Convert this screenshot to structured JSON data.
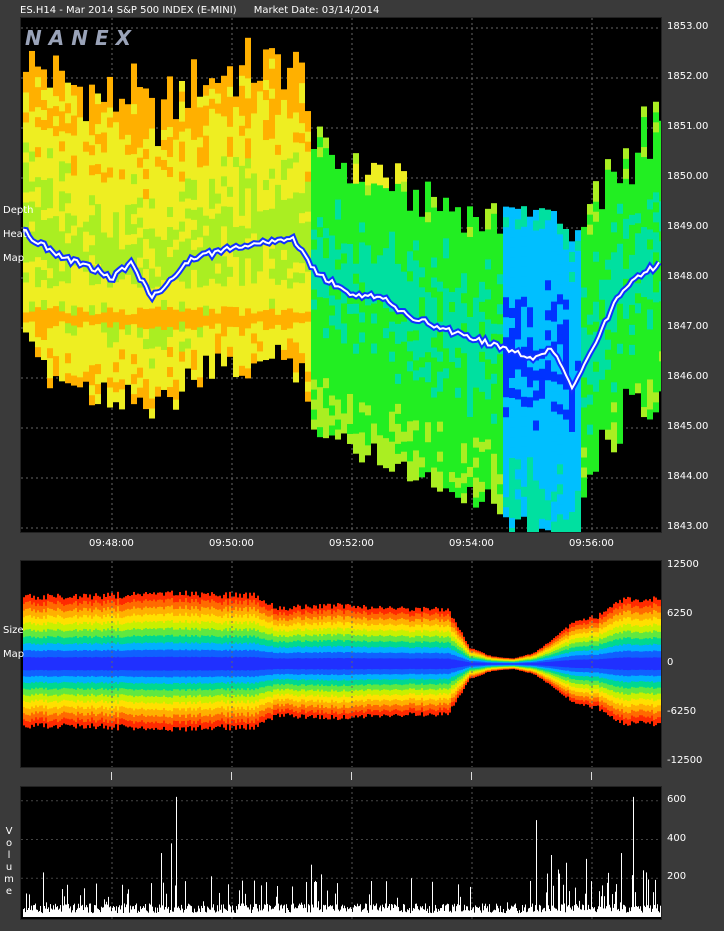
{
  "header": {
    "instrument": "ES.H14 - Mar 2014 S&P 500 INDEX (E-MINI)",
    "market_date": "Market Date: 03/14/2014"
  },
  "brand": "NANEX",
  "panels": {
    "heat": {
      "label": "Depth\n\nHeat\n\nMap"
    },
    "size": {
      "label": "Size\n\nMap"
    },
    "volume": {
      "label": "Volume"
    }
  },
  "chart_data": [
    {
      "type": "heatmap",
      "title": "Depth Heat Map",
      "xlabel": "",
      "ylabel": "",
      "x_ticks": [
        "09:48:00",
        "09:50:00",
        "09:52:00",
        "09:54:00",
        "09:56:00"
      ],
      "y_ticks": [
        "1853.00",
        "1852.00",
        "1851.00",
        "1850.00",
        "1849.00",
        "1848.00",
        "1847.00",
        "1846.00",
        "1845.00",
        "1844.00",
        "1843.00"
      ],
      "ylim": [
        1843,
        1853
      ],
      "price_path": [
        {
          "t": "09:46:15",
          "p": 1849.4
        },
        {
          "t": "09:46:40",
          "p": 1848.8
        },
        {
          "t": "09:47:10",
          "p": 1848.4
        },
        {
          "t": "09:47:40",
          "p": 1848.2
        },
        {
          "t": "09:48:00",
          "p": 1848.0
        },
        {
          "t": "09:48:20",
          "p": 1848.3
        },
        {
          "t": "09:48:40",
          "p": 1847.6
        },
        {
          "t": "09:49:00",
          "p": 1848.0
        },
        {
          "t": "09:49:20",
          "p": 1848.4
        },
        {
          "t": "09:49:40",
          "p": 1848.5
        },
        {
          "t": "09:50:00",
          "p": 1848.6
        },
        {
          "t": "09:50:30",
          "p": 1848.7
        },
        {
          "t": "09:51:00",
          "p": 1848.8
        },
        {
          "t": "09:51:20",
          "p": 1848.2
        },
        {
          "t": "09:51:40",
          "p": 1847.9
        },
        {
          "t": "09:52:00",
          "p": 1847.7
        },
        {
          "t": "09:52:30",
          "p": 1847.6
        },
        {
          "t": "09:53:00",
          "p": 1847.2
        },
        {
          "t": "09:53:30",
          "p": 1847.0
        },
        {
          "t": "09:54:00",
          "p": 1846.8
        },
        {
          "t": "09:54:30",
          "p": 1846.6
        },
        {
          "t": "09:55:00",
          "p": 1846.4
        },
        {
          "t": "09:55:20",
          "p": 1846.6
        },
        {
          "t": "09:55:40",
          "p": 1845.8
        },
        {
          "t": "09:56:00",
          "p": 1846.6
        },
        {
          "t": "09:56:20",
          "p": 1847.4
        },
        {
          "t": "09:56:40",
          "p": 1848.0
        },
        {
          "t": "09:57:10",
          "p": 1848.3
        }
      ]
    },
    {
      "type": "area",
      "title": "Size Map",
      "y_ticks": [
        "12500",
        "6250",
        "0",
        "-6250",
        "-12500"
      ],
      "ylim": [
        -12500,
        12500
      ],
      "series": [
        {
          "values": [
            8800,
            8600,
            8700,
            8700,
            8800,
            8900,
            8900,
            9000,
            9000,
            8900,
            8900,
            8800,
            7200,
            7300,
            7400,
            7500,
            7300,
            7200,
            7100,
            7100,
            6900,
            2100,
            1000,
            700,
            1400,
            3400,
            5700,
            6100,
            8300,
            8300,
            8400
          ]
        }
      ]
    },
    {
      "type": "bar",
      "title": "Volume",
      "y_ticks": [
        "600",
        "400",
        "200"
      ],
      "ylim": [
        0,
        640
      ]
    }
  ]
}
